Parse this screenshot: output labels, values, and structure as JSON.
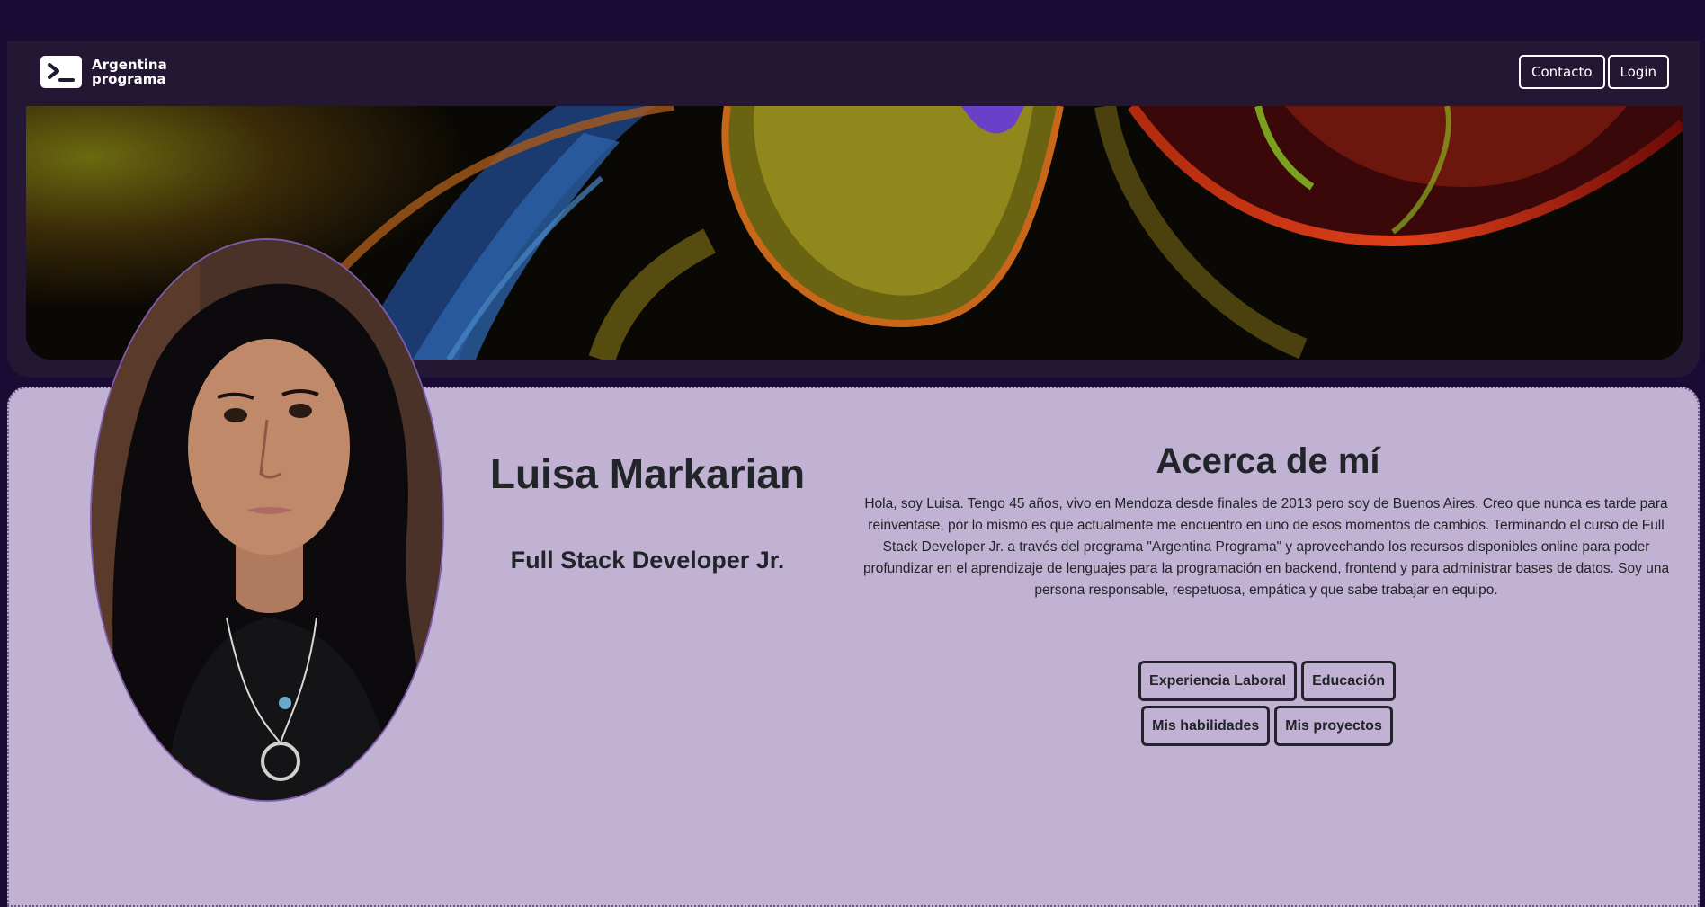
{
  "navbar": {
    "logo_line1": "Argentina",
    "logo_line2": "programa",
    "contact_label": "Contacto",
    "login_label": "Login"
  },
  "profile": {
    "name": "Luisa Markarian",
    "role": "Full Stack Developer Jr."
  },
  "about": {
    "title": "Acerca de mí",
    "text": "Hola, soy Luisa. Tengo 45 años, vivo en Mendoza desde finales de 2013 pero soy de Buenos Aires. Creo que nunca es tarde para reinventase, por lo mismo es que actualmente me encuentro en uno de esos momentos de cambios. Terminando el curso de Full Stack Developer Jr. a través del programa \"Argentina Programa\" y aprovechando los recursos disponibles online para poder profundizar en el aprendizaje de lenguajes para la programación en backend, frontend y para administrar bases de datos. Soy una persona responsable, respetuosa, empática y que sabe trabajar en equipo."
  },
  "sections": {
    "experience_label": "Experiencia Laboral",
    "education_label": "Educación",
    "skills_label": "Mis habilidades",
    "projects_label": "Mis proyectos"
  },
  "colors": {
    "page_background": "#1a0b35",
    "header_background": "#231733",
    "card_background": "#c1b1d3",
    "text_dark": "#212529"
  }
}
